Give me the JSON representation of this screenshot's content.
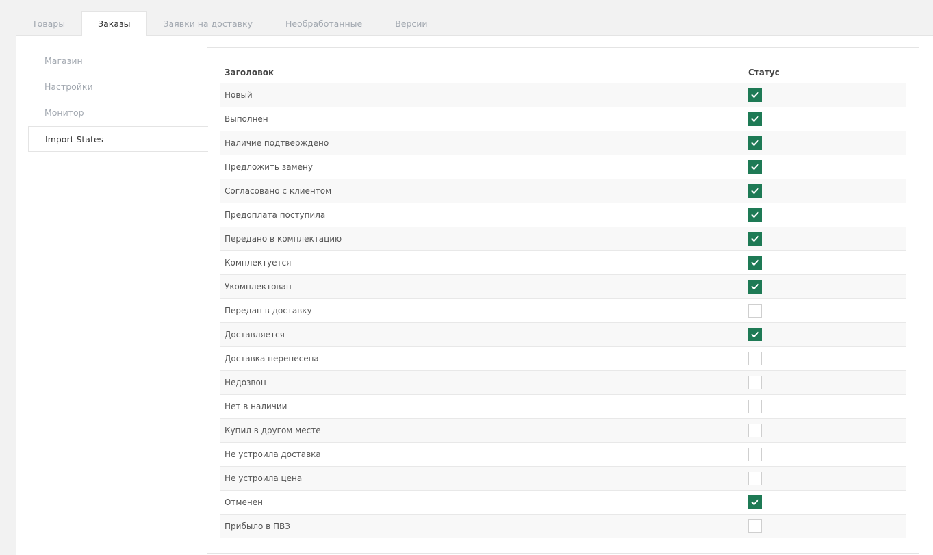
{
  "tabs": [
    {
      "label": "Товары",
      "active": false
    },
    {
      "label": "Заказы",
      "active": true
    },
    {
      "label": "Заявки на доставку",
      "active": false
    },
    {
      "label": "Необработанные",
      "active": false
    },
    {
      "label": "Версии",
      "active": false
    }
  ],
  "sidenav": [
    {
      "label": "Магазин",
      "active": false
    },
    {
      "label": "Настройки",
      "active": false
    },
    {
      "label": "Монитор",
      "active": false
    },
    {
      "label": "Import States",
      "active": true
    }
  ],
  "table": {
    "headers": {
      "title": "Заголовок",
      "status": "Статус"
    },
    "rows": [
      {
        "title": "Новый",
        "checked": true
      },
      {
        "title": "Выполнен",
        "checked": true
      },
      {
        "title": "Наличие подтверждено",
        "checked": true
      },
      {
        "title": "Предложить замену",
        "checked": true
      },
      {
        "title": "Согласовано с клиентом",
        "checked": true
      },
      {
        "title": "Предоплата поступила",
        "checked": true
      },
      {
        "title": "Передано в комплектацию",
        "checked": true
      },
      {
        "title": "Комплектуется",
        "checked": true
      },
      {
        "title": "Укомплектован",
        "checked": true
      },
      {
        "title": "Передан в доставку",
        "checked": false
      },
      {
        "title": "Доставляется",
        "checked": true
      },
      {
        "title": "Доставка перенесена",
        "checked": false
      },
      {
        "title": "Недозвон",
        "checked": false
      },
      {
        "title": "Нет в наличии",
        "checked": false
      },
      {
        "title": "Купил в другом месте",
        "checked": false
      },
      {
        "title": "Не устроила доставка",
        "checked": false
      },
      {
        "title": "Не устроила цена",
        "checked": false
      },
      {
        "title": "Отменен",
        "checked": true
      },
      {
        "title": "Прибыло в ПВЗ",
        "checked": false
      }
    ]
  },
  "colors": {
    "accent": "#1e7a55",
    "background": "#f2f2f2",
    "muted_text": "#a3a9b1"
  }
}
